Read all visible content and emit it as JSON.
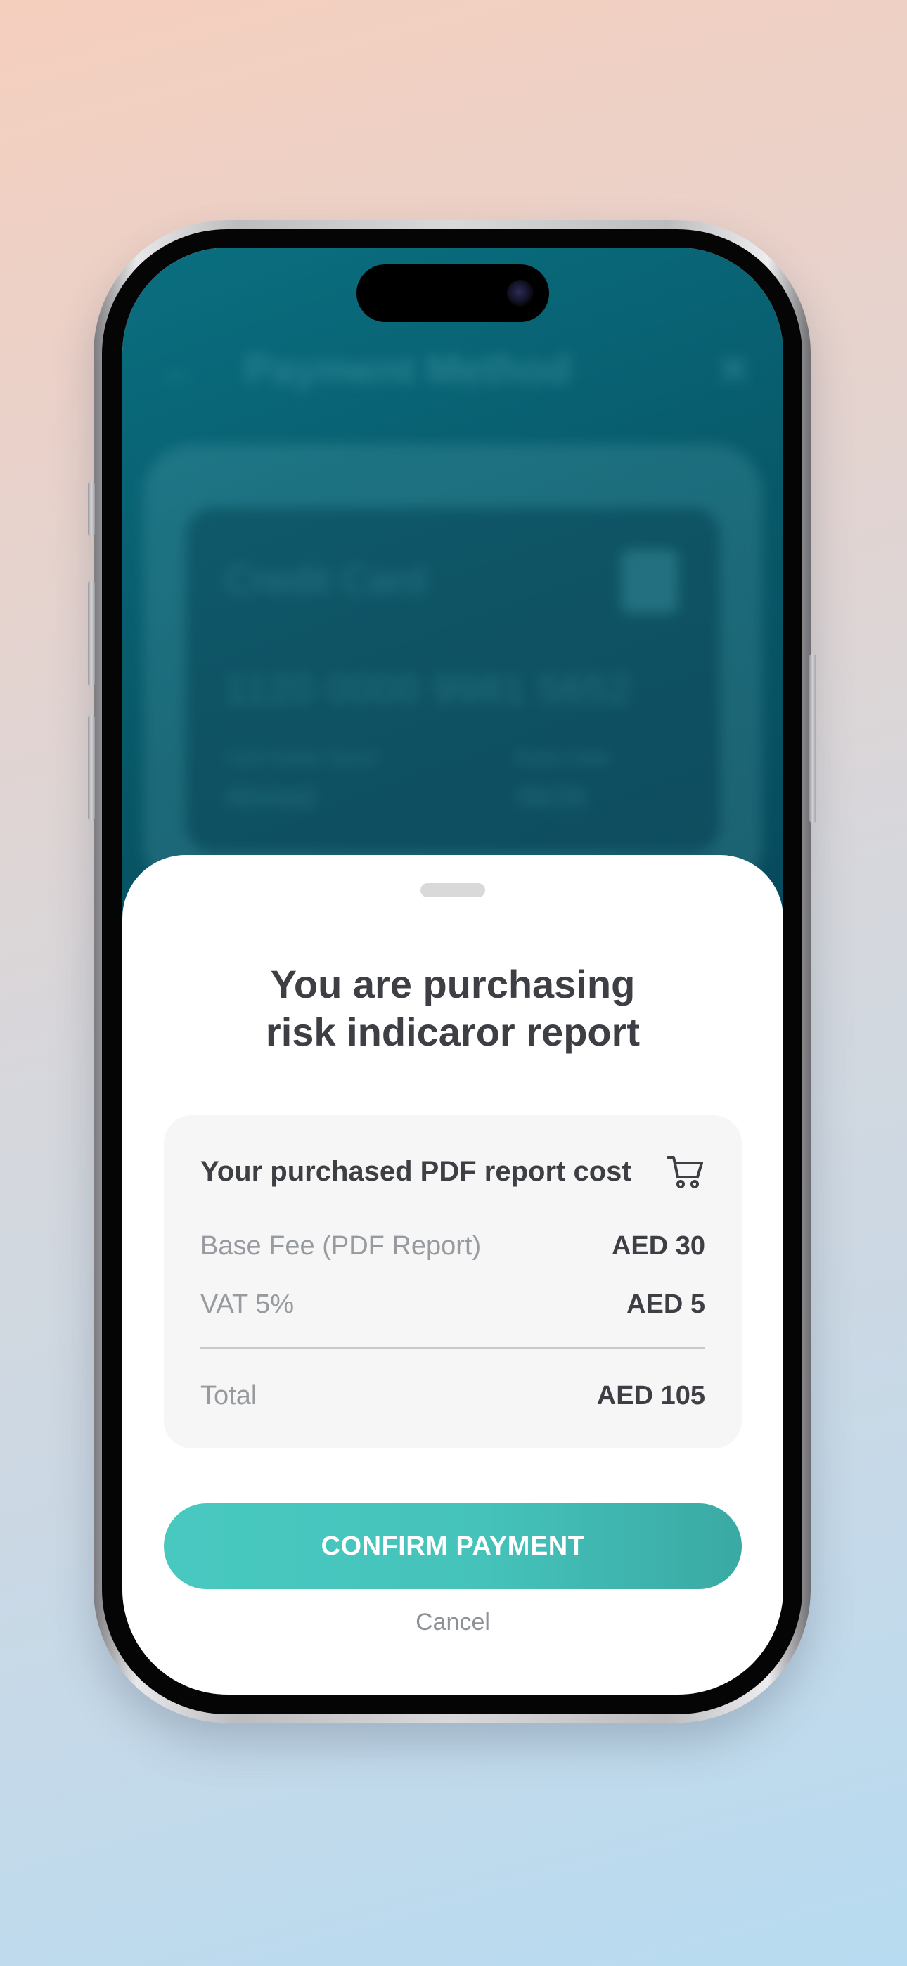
{
  "background_app": {
    "header_title": "Payment Method",
    "card_type": "Credit Card",
    "card_number": "1120 0000 9981 5652",
    "card_holder_label": "Card Holder Name",
    "card_holder_value": "Ahmed",
    "expiry_label": "Expiry Date",
    "expiry_value": "06/26"
  },
  "sheet": {
    "title_line1": "You are purchasing",
    "title_line2": "risk indicaror report",
    "cost_heading": "Your purchased PDF report cost",
    "rows": [
      {
        "label": "Base Fee (PDF Report)",
        "value": "AED 30"
      },
      {
        "label": "VAT 5%",
        "value": "AED 5"
      }
    ],
    "total": {
      "label": "Total",
      "value": "AED 105"
    },
    "confirm_label": "CONFIRM PAYMENT",
    "cancel_label": "Cancel"
  },
  "icons": {
    "cart": "cart-icon",
    "back": "arrow-left-icon",
    "close": "close-icon"
  },
  "colors": {
    "accent": "#48c9c0",
    "title_text": "#3d3f44",
    "muted_text": "#979a9f",
    "background_app": "#075868"
  }
}
